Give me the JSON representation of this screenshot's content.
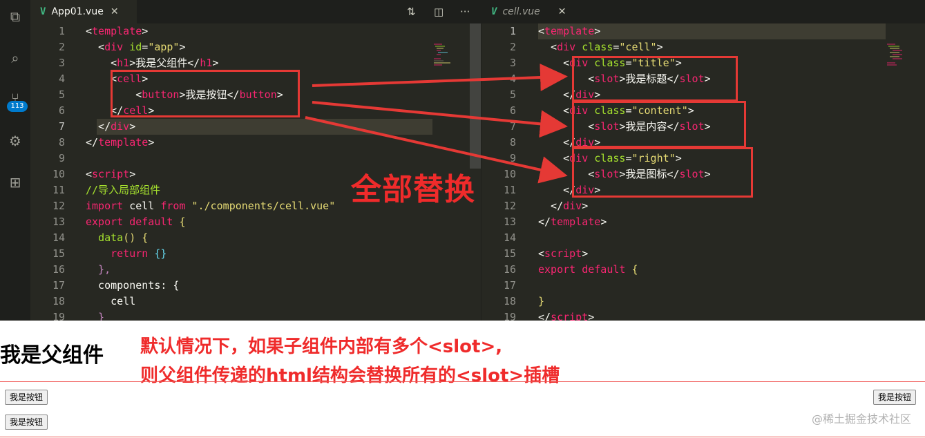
{
  "left_tab": {
    "icon": "V",
    "title": "App01.vue",
    "close": "✕"
  },
  "right_tab": {
    "icon": "V",
    "title": "cell.vue",
    "close": "✕"
  },
  "tab_actions": {
    "compare": "⇅",
    "split": "◫",
    "more": "···"
  },
  "activity_bar": {
    "badge": "113"
  },
  "left_lines": {
    "n": [
      "1",
      "2",
      "3",
      "4",
      "5",
      "6",
      "7",
      "8",
      "9",
      "10",
      "11",
      "12",
      "13",
      "14",
      "15",
      "16",
      "17",
      "18",
      "19"
    ]
  },
  "right_lines": {
    "n": [
      "1",
      "2",
      "3",
      "4",
      "5",
      "6",
      "7",
      "8",
      "9",
      "10",
      "11",
      "12",
      "13",
      "14",
      "15",
      "16",
      "17",
      "18",
      "19"
    ]
  },
  "left_code": {
    "l1": [
      "<",
      "template",
      ">"
    ],
    "l2": [
      "  <",
      "div",
      " ",
      "id",
      "=",
      "\"app\"",
      ">"
    ],
    "l3": [
      "    <",
      "h1",
      ">我是父组件</",
      "h1",
      ">"
    ],
    "l4": [
      "    <",
      "cell",
      ">"
    ],
    "l5": [
      "        <",
      "button",
      ">我是按钮</",
      "button",
      ">"
    ],
    "l6": [
      "    </",
      "cell",
      ">"
    ],
    "l7": [
      "  </",
      "div",
      ">"
    ],
    "l8": [
      "</",
      "template",
      ">"
    ],
    "l10": [
      "<",
      "script",
      ">"
    ],
    "l11": "//导入局部组件",
    "l12": [
      "import",
      " cell ",
      "from",
      " ",
      "\"./components/cell.vue\""
    ],
    "l13": [
      "export",
      " ",
      "default",
      " {"
    ],
    "l14": [
      "  ",
      "data",
      "() {"
    ],
    "l15": [
      "    ",
      "return",
      " {}"
    ],
    "l16": "  },",
    "l17": [
      "  components: {"
    ],
    "l18": "    cell",
    "l19": "  }"
  },
  "right_code": {
    "l1": [
      "<",
      "template",
      ">"
    ],
    "l2": [
      "  <",
      "div",
      " ",
      "class",
      "=",
      "\"cell\"",
      ">"
    ],
    "l3": [
      "    <",
      "div",
      " ",
      "class",
      "=",
      "\"title\"",
      ">"
    ],
    "l4": [
      "        <",
      "slot",
      ">我是标题</",
      "slot",
      ">"
    ],
    "l5": [
      "    </",
      "div",
      ">"
    ],
    "l6": [
      "    <",
      "div",
      " ",
      "class",
      "=",
      "\"content\"",
      ">"
    ],
    "l7": [
      "        <",
      "slot",
      ">我是内容</",
      "slot",
      ">"
    ],
    "l8": [
      "    </",
      "div",
      ">"
    ],
    "l9": [
      "    <",
      "div",
      " ",
      "class",
      "=",
      "\"right\"",
      ">"
    ],
    "l10": [
      "        <",
      "slot",
      ">我是图标</",
      "slot",
      ">"
    ],
    "l11": [
      "    </",
      "div",
      ">"
    ],
    "l12": [
      "  </",
      "div",
      ">"
    ],
    "l13": [
      "</",
      "template",
      ">"
    ],
    "l15": [
      "<",
      "script",
      ">"
    ],
    "l16": [
      "export",
      " ",
      "default",
      " {"
    ],
    "l18": "}",
    "l19": [
      "</",
      "script",
      ">"
    ]
  },
  "overlay_label": "全部替换",
  "preview": {
    "heading": "我是父组件",
    "note_line1": "默认情况下，如果子组件内部有多个<slot>,",
    "note_line2": "则父组件传递的html结构会替换所有的<slot>插槽",
    "button1": "我是按钮",
    "button2": "我是按钮",
    "button3": "我是按钮",
    "watermark": "@稀土掘金技术社区"
  },
  "colors": {
    "editor_bg": "#272822",
    "tag": "#f92672",
    "attr": "#a6e22e",
    "string": "#e6db74",
    "comment": "#75715e",
    "keyword": "#66d9ef",
    "annotation_red": "#e53935"
  }
}
